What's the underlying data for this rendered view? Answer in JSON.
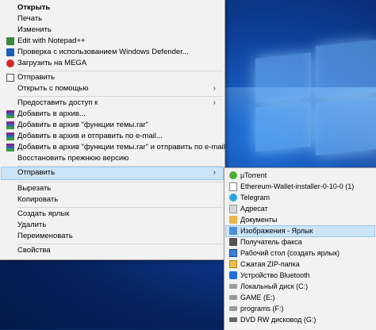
{
  "context_menu": {
    "items": [
      {
        "label": "Открыть",
        "bold": true
      },
      {
        "label": "Печать"
      },
      {
        "label": "Изменить"
      },
      {
        "label": "Edit with Notepad++",
        "icon": "notepad-plus-plus-icon"
      },
      {
        "label": "Проверка с использованием Windows Defender...",
        "icon": "windows-defender-icon"
      },
      {
        "label": "Загрузить на MEGA",
        "icon": "mega-icon"
      },
      {
        "label": "Отправить",
        "icon": "share-icon"
      },
      {
        "label": "Открыть с помощью",
        "submenu_arrow": "›"
      },
      {
        "label": "Предоставить доступ к",
        "submenu_arrow": "›"
      },
      {
        "label": "Добавить в архив...",
        "icon": "winrar-icon"
      },
      {
        "label": "Добавить в архив \"функции темы.rar\"",
        "icon": "winrar-icon"
      },
      {
        "label": "Добавить в архив и отправить по e-mail...",
        "icon": "winrar-icon"
      },
      {
        "label": "Добавить в архив \"функции темы.rar\" и отправить по e-mail",
        "icon": "winrar-icon"
      },
      {
        "label": "Восстановить прежнюю версию"
      },
      {
        "label": "Отправить",
        "submenu_arrow": "›",
        "highlighted": true
      },
      {
        "label": "Вырезать"
      },
      {
        "label": "Копировать"
      },
      {
        "label": "Создать ярлык"
      },
      {
        "label": "Удалить"
      },
      {
        "label": "Переименовать"
      },
      {
        "label": "Свойства"
      }
    ]
  },
  "send_to_submenu": {
    "items": [
      {
        "label": "µTorrent",
        "icon": "utorrent-icon"
      },
      {
        "label": "Ethereum-Wallet-installer-0-10-0 (1)",
        "icon": "document-icon"
      },
      {
        "label": "Telegram",
        "icon": "telegram-icon"
      },
      {
        "label": "Адресат",
        "icon": "contact-icon"
      },
      {
        "label": "Документы",
        "icon": "documents-folder-icon"
      },
      {
        "label": "Изображения - Ярлык",
        "icon": "pictures-folder-icon",
        "highlighted": true
      },
      {
        "label": "Получатель факса",
        "icon": "fax-icon"
      },
      {
        "label": "Рабочий стол (создать ярлык)",
        "icon": "desktop-icon"
      },
      {
        "label": "Сжатая ZIP-папка",
        "icon": "zip-folder-icon"
      },
      {
        "label": "Устройство Bluetooth",
        "icon": "bluetooth-icon"
      },
      {
        "label": "Локальный диск (C:)",
        "icon": "hard-drive-icon"
      },
      {
        "label": "GAME (E:)",
        "icon": "hard-drive-icon"
      },
      {
        "label": "programs (F:)",
        "icon": "hard-drive-icon"
      },
      {
        "label": "DVD RW дисковод (G:)",
        "icon": "dvd-drive-icon"
      }
    ]
  },
  "colors": {
    "menu_background": "#f2f2f2",
    "highlight": "#cce4f7",
    "highlight_border": "#99c9ef",
    "desktop_blue": "#0e3f9a"
  }
}
